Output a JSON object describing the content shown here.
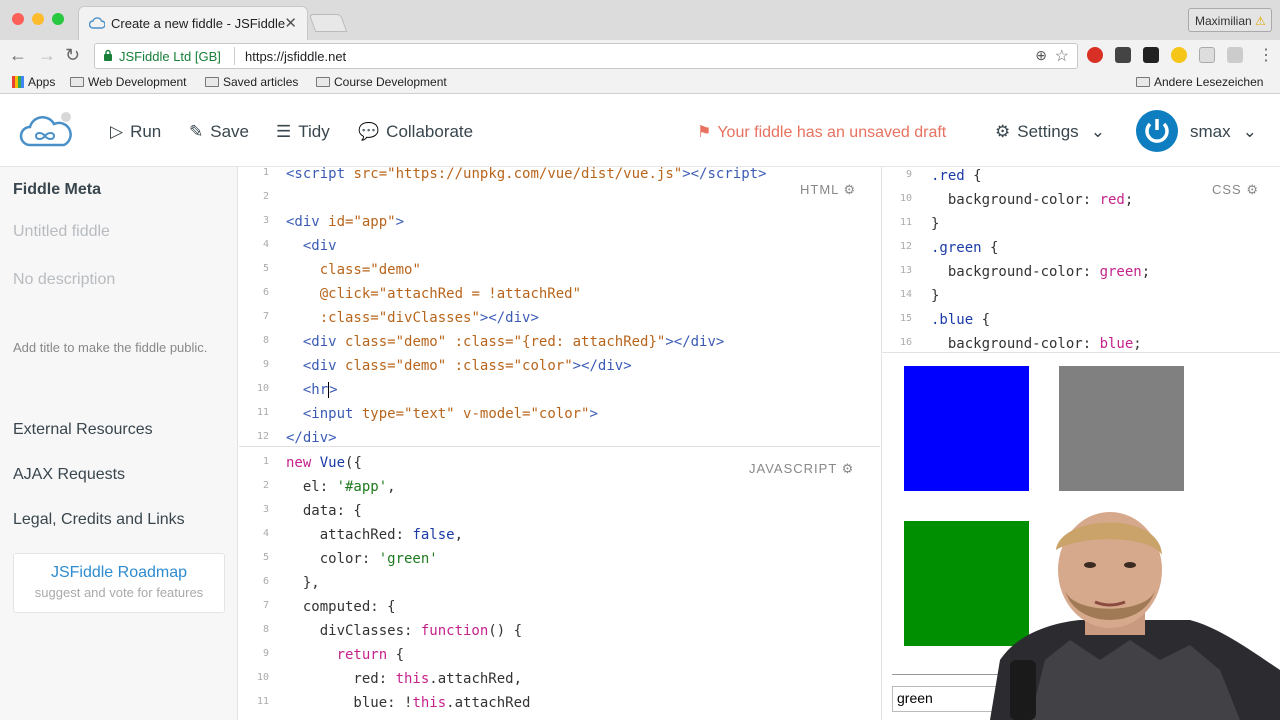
{
  "browser": {
    "tab_title": "Create a new fiddle - JSFiddle",
    "tab_close": "✕",
    "profile_name": "Maximilian",
    "url_org": "JSFiddle Ltd [GB]",
    "url": "https://jsfiddle.net",
    "bookmarks": [
      "Apps",
      "Web Development",
      "Saved articles",
      "Course Development"
    ],
    "other_bookmarks": "Andere Lesezeichen"
  },
  "header": {
    "run": "Run",
    "save": "Save",
    "tidy": "Tidy",
    "collaborate": "Collaborate",
    "draft_notice": "Your fiddle has an unsaved draft",
    "settings": "Settings",
    "user": "smax"
  },
  "sidebar": {
    "title": "Fiddle Meta",
    "name_placeholder": "Untitled fiddle",
    "desc_placeholder": "No description",
    "hint": "Add title to make the fiddle public.",
    "links": [
      "External Resources",
      "AJAX Requests",
      "Legal, Credits and Links"
    ],
    "roadmap_title": "JSFiddle Roadmap",
    "roadmap_sub": "suggest and vote for features"
  },
  "html_panel": {
    "label": "HTML",
    "line_numbers": [
      "1",
      "2",
      "3",
      "4",
      "5",
      "6",
      "7",
      "8",
      "9",
      "10",
      "11",
      "12"
    ]
  },
  "js_panel": {
    "label": "JAVASCRIPT",
    "line_numbers": [
      "1",
      "2",
      "3",
      "4",
      "5",
      "6",
      "7",
      "8",
      "9",
      "10",
      "11"
    ]
  },
  "css_panel": {
    "label": "CSS",
    "line_numbers": [
      "9",
      "10",
      "11",
      "12",
      "13",
      "14",
      "15",
      "16"
    ]
  },
  "result": {
    "input_value": "green",
    "box_colors": [
      "#0000ff",
      "#808080",
      "#008f00"
    ]
  }
}
